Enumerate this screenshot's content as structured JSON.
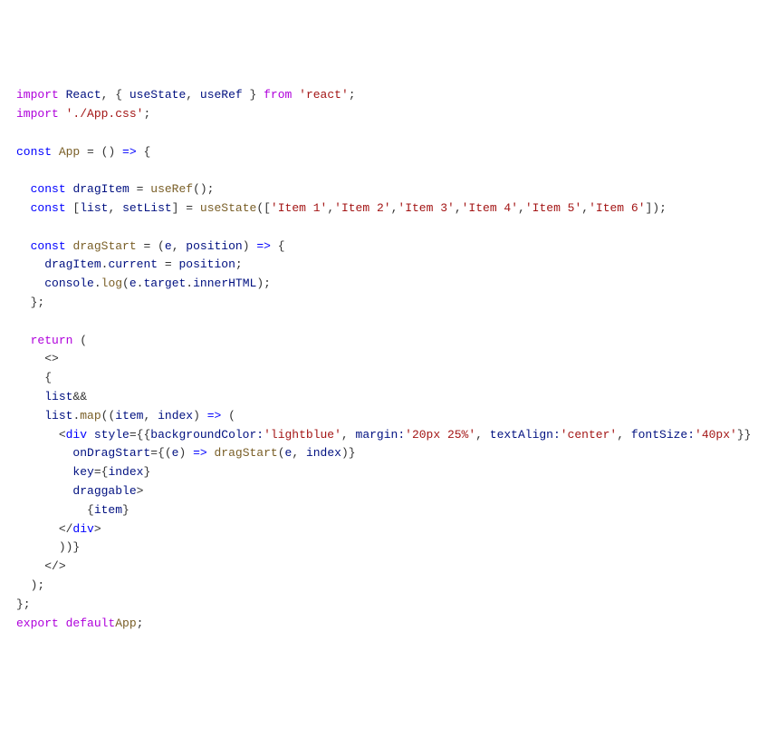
{
  "code": {
    "lines": [
      {
        "indent": 0,
        "tokens": [
          {
            "cls": "kw-purple",
            "t": "import"
          },
          {
            "cls": "plain",
            "t": " "
          },
          {
            "cls": "ident",
            "t": "React"
          },
          {
            "cls": "plain",
            "t": ", { "
          },
          {
            "cls": "ident",
            "t": "useState"
          },
          {
            "cls": "plain",
            "t": ", "
          },
          {
            "cls": "ident",
            "t": "useRef"
          },
          {
            "cls": "plain",
            "t": " } "
          },
          {
            "cls": "kw-purple",
            "t": "from"
          },
          {
            "cls": "plain",
            "t": " "
          },
          {
            "cls": "str",
            "t": "'react'"
          },
          {
            "cls": "plain",
            "t": ";"
          }
        ]
      },
      {
        "indent": 0,
        "tokens": [
          {
            "cls": "kw-purple",
            "t": "import"
          },
          {
            "cls": "plain",
            "t": " "
          },
          {
            "cls": "str",
            "t": "'./App.css'"
          },
          {
            "cls": "plain",
            "t": ";"
          }
        ]
      },
      {
        "indent": 0,
        "tokens": []
      },
      {
        "indent": 0,
        "tokens": [
          {
            "cls": "kw-blue",
            "t": "const"
          },
          {
            "cls": "plain",
            "t": " "
          },
          {
            "cls": "func",
            "t": "App"
          },
          {
            "cls": "plain",
            "t": " = () "
          },
          {
            "cls": "kw-blue",
            "t": "=>"
          },
          {
            "cls": "plain",
            "t": " {"
          }
        ]
      },
      {
        "indent": 0,
        "tokens": []
      },
      {
        "indent": 1,
        "tokens": [
          {
            "cls": "kw-blue",
            "t": "const"
          },
          {
            "cls": "plain",
            "t": " "
          },
          {
            "cls": "ident",
            "t": "dragItem"
          },
          {
            "cls": "plain",
            "t": " = "
          },
          {
            "cls": "func",
            "t": "useRef"
          },
          {
            "cls": "plain",
            "t": "();"
          }
        ]
      },
      {
        "indent": 1,
        "tokens": [
          {
            "cls": "kw-blue",
            "t": "const"
          },
          {
            "cls": "plain",
            "t": " ["
          },
          {
            "cls": "ident",
            "t": "list"
          },
          {
            "cls": "plain",
            "t": ", "
          },
          {
            "cls": "ident",
            "t": "setList"
          },
          {
            "cls": "plain",
            "t": "] = "
          },
          {
            "cls": "func",
            "t": "useState"
          },
          {
            "cls": "plain",
            "t": "(["
          },
          {
            "cls": "str",
            "t": "'Item 1'"
          },
          {
            "cls": "plain",
            "t": ","
          },
          {
            "cls": "str",
            "t": "'Item 2'"
          },
          {
            "cls": "plain",
            "t": ","
          },
          {
            "cls": "str",
            "t": "'Item 3'"
          },
          {
            "cls": "plain",
            "t": ","
          },
          {
            "cls": "str",
            "t": "'Item 4'"
          },
          {
            "cls": "plain",
            "t": ","
          },
          {
            "cls": "str",
            "t": "'Item 5'"
          },
          {
            "cls": "plain",
            "t": ","
          },
          {
            "cls": "str",
            "t": "'Item 6'"
          },
          {
            "cls": "plain",
            "t": "]);"
          }
        ]
      },
      {
        "indent": 0,
        "tokens": []
      },
      {
        "indent": 1,
        "tokens": [
          {
            "cls": "kw-blue",
            "t": "const"
          },
          {
            "cls": "plain",
            "t": " "
          },
          {
            "cls": "func",
            "t": "dragStart"
          },
          {
            "cls": "plain",
            "t": " = ("
          },
          {
            "cls": "ident",
            "t": "e"
          },
          {
            "cls": "plain",
            "t": ", "
          },
          {
            "cls": "ident",
            "t": "position"
          },
          {
            "cls": "plain",
            "t": ") "
          },
          {
            "cls": "kw-blue",
            "t": "=>"
          },
          {
            "cls": "plain",
            "t": " {"
          }
        ]
      },
      {
        "indent": 2,
        "tokens": [
          {
            "cls": "ident",
            "t": "dragItem"
          },
          {
            "cls": "plain",
            "t": "."
          },
          {
            "cls": "ident",
            "t": "current"
          },
          {
            "cls": "plain",
            "t": " = "
          },
          {
            "cls": "ident",
            "t": "position"
          },
          {
            "cls": "plain",
            "t": ";"
          }
        ]
      },
      {
        "indent": 2,
        "tokens": [
          {
            "cls": "ident",
            "t": "console"
          },
          {
            "cls": "plain",
            "t": "."
          },
          {
            "cls": "func",
            "t": "log"
          },
          {
            "cls": "plain",
            "t": "("
          },
          {
            "cls": "ident",
            "t": "e"
          },
          {
            "cls": "plain",
            "t": "."
          },
          {
            "cls": "ident",
            "t": "target"
          },
          {
            "cls": "plain",
            "t": "."
          },
          {
            "cls": "ident",
            "t": "innerHTML"
          },
          {
            "cls": "plain",
            "t": ");"
          }
        ]
      },
      {
        "indent": 1,
        "tokens": [
          {
            "cls": "plain",
            "t": "};"
          }
        ]
      },
      {
        "indent": 0,
        "tokens": []
      },
      {
        "indent": 1,
        "tokens": [
          {
            "cls": "kw-purple",
            "t": "return"
          },
          {
            "cls": "plain",
            "t": " ("
          }
        ]
      },
      {
        "indent": 2,
        "tokens": [
          {
            "cls": "plain",
            "t": "<>"
          }
        ]
      },
      {
        "indent": 2,
        "tokens": [
          {
            "cls": "plain",
            "t": "{"
          }
        ]
      },
      {
        "indent": 2,
        "tokens": [
          {
            "cls": "ident",
            "t": "list"
          },
          {
            "cls": "plain",
            "t": "&&"
          }
        ]
      },
      {
        "indent": 2,
        "tokens": [
          {
            "cls": "ident",
            "t": "list"
          },
          {
            "cls": "plain",
            "t": "."
          },
          {
            "cls": "func",
            "t": "map"
          },
          {
            "cls": "plain",
            "t": "(("
          },
          {
            "cls": "ident",
            "t": "item"
          },
          {
            "cls": "plain",
            "t": ", "
          },
          {
            "cls": "ident",
            "t": "index"
          },
          {
            "cls": "plain",
            "t": ") "
          },
          {
            "cls": "kw-blue",
            "t": "=>"
          },
          {
            "cls": "plain",
            "t": " ("
          }
        ]
      },
      {
        "indent": 3,
        "tokens": [
          {
            "cls": "plain",
            "t": "<"
          },
          {
            "cls": "kw-blue",
            "t": "div"
          },
          {
            "cls": "plain",
            "t": " "
          },
          {
            "cls": "ident",
            "t": "style"
          },
          {
            "cls": "plain",
            "t": "={{"
          },
          {
            "cls": "ident",
            "t": "backgroundColor:"
          },
          {
            "cls": "str",
            "t": "'lightblue'"
          },
          {
            "cls": "plain",
            "t": ", "
          },
          {
            "cls": "ident",
            "t": "margin:"
          },
          {
            "cls": "str",
            "t": "'20px 25%'"
          },
          {
            "cls": "plain",
            "t": ", "
          },
          {
            "cls": "ident",
            "t": "textAlign:"
          },
          {
            "cls": "str",
            "t": "'center'"
          },
          {
            "cls": "plain",
            "t": ", "
          },
          {
            "cls": "ident",
            "t": "fontSize:"
          },
          {
            "cls": "str",
            "t": "'40px'"
          },
          {
            "cls": "plain",
            "t": "}}"
          }
        ]
      },
      {
        "indent": 4,
        "tokens": [
          {
            "cls": "ident",
            "t": "onDragStart"
          },
          {
            "cls": "plain",
            "t": "={("
          },
          {
            "cls": "ident",
            "t": "e"
          },
          {
            "cls": "plain",
            "t": ") "
          },
          {
            "cls": "kw-blue",
            "t": "=>"
          },
          {
            "cls": "plain",
            "t": " "
          },
          {
            "cls": "func",
            "t": "dragStart"
          },
          {
            "cls": "plain",
            "t": "("
          },
          {
            "cls": "ident",
            "t": "e"
          },
          {
            "cls": "plain",
            "t": ", "
          },
          {
            "cls": "ident",
            "t": "index"
          },
          {
            "cls": "plain",
            "t": ")}"
          }
        ]
      },
      {
        "indent": 4,
        "tokens": [
          {
            "cls": "ident",
            "t": "key"
          },
          {
            "cls": "plain",
            "t": "={"
          },
          {
            "cls": "ident",
            "t": "index"
          },
          {
            "cls": "plain",
            "t": "}"
          }
        ]
      },
      {
        "indent": 4,
        "tokens": [
          {
            "cls": "ident",
            "t": "draggable"
          },
          {
            "cls": "plain",
            "t": ">"
          }
        ]
      },
      {
        "indent": 5,
        "tokens": [
          {
            "cls": "plain",
            "t": "{"
          },
          {
            "cls": "ident",
            "t": "item"
          },
          {
            "cls": "plain",
            "t": "}"
          }
        ]
      },
      {
        "indent": 3,
        "tokens": [
          {
            "cls": "plain",
            "t": "</"
          },
          {
            "cls": "kw-blue",
            "t": "div"
          },
          {
            "cls": "plain",
            "t": ">"
          }
        ]
      },
      {
        "indent": 3,
        "tokens": [
          {
            "cls": "plain",
            "t": "))}"
          }
        ]
      },
      {
        "indent": 2,
        "tokens": [
          {
            "cls": "plain",
            "t": "</>"
          }
        ]
      },
      {
        "indent": 1,
        "tokens": [
          {
            "cls": "plain",
            "t": ");"
          }
        ]
      },
      {
        "indent": 0,
        "tokens": [
          {
            "cls": "plain",
            "t": "};"
          }
        ]
      },
      {
        "indent": 0,
        "tokens": [
          {
            "cls": "kw-purple",
            "t": "export"
          },
          {
            "cls": "plain",
            "t": " "
          },
          {
            "cls": "kw-purple",
            "t": "default"
          },
          {
            "cls": "func",
            "t": "App"
          },
          {
            "cls": "plain",
            "t": ";"
          }
        ]
      }
    ]
  },
  "indent_unit": "  "
}
